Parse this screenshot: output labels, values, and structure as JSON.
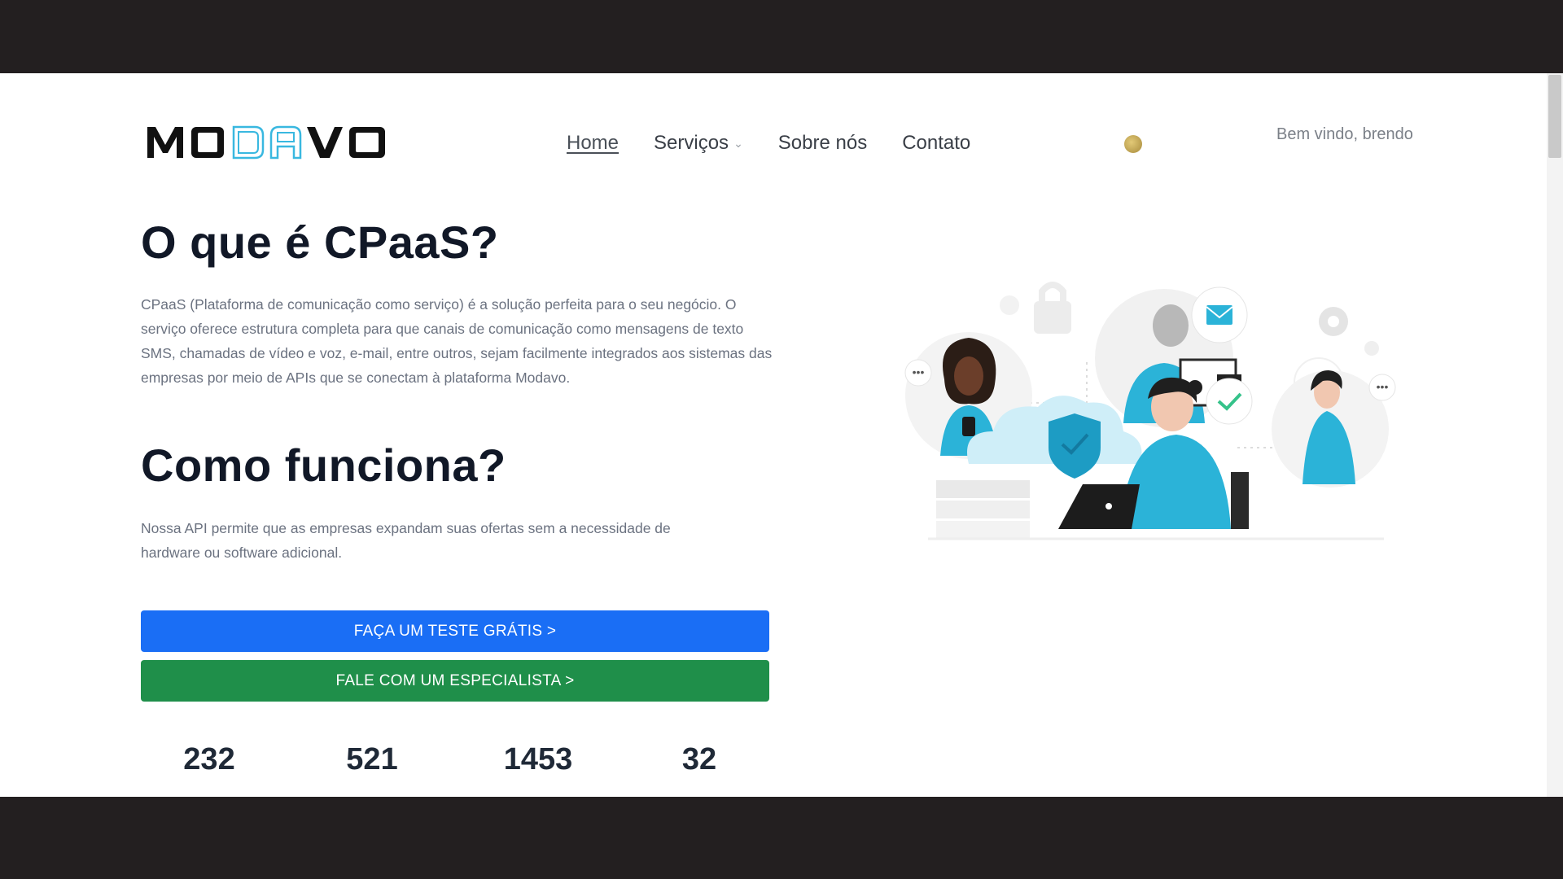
{
  "header": {
    "logo_text": "MODAVO",
    "nav": [
      {
        "label": "Home",
        "active": true
      },
      {
        "label": "Serviços",
        "has_dropdown": true
      },
      {
        "label": "Sobre nós"
      },
      {
        "label": "Contato"
      }
    ],
    "welcome": "Bem vindo, brendo"
  },
  "main": {
    "section1_title": "O que é CPaaS?",
    "section1_text": "CPaaS (Plataforma de comunicação como serviço) é a solução perfeita para o seu negócio. O serviço oferece estrutura completa para que canais de comunicação como mensagens de texto SMS, chamadas de vídeo e voz, e-mail, entre outros, sejam facilmente integrados aos sistemas das empresas por meio de APIs que se conectam à plataforma Modavo.",
    "section2_title": "Como funciona?",
    "section2_text": "Nossa API permite que as empresas expandam suas ofertas sem a necessidade de hardware ou software adicional.",
    "cta_primary": "FAÇA UM TESTE GRÁTIS >",
    "cta_secondary": "FALE COM UM ESPECIALISTA >",
    "stats": [
      "232",
      "521",
      "1453",
      "32"
    ]
  },
  "colors": {
    "primary": "#1a6ef5",
    "success": "#1f8f4a",
    "logo_accent": "#39b8e0",
    "illustration_accent": "#2bb3d8"
  },
  "icons": [
    "chevron-down-icon",
    "mail-icon",
    "lock-icon",
    "gear-icon",
    "shield-icon",
    "check-icon",
    "chat-dots-icon"
  ]
}
